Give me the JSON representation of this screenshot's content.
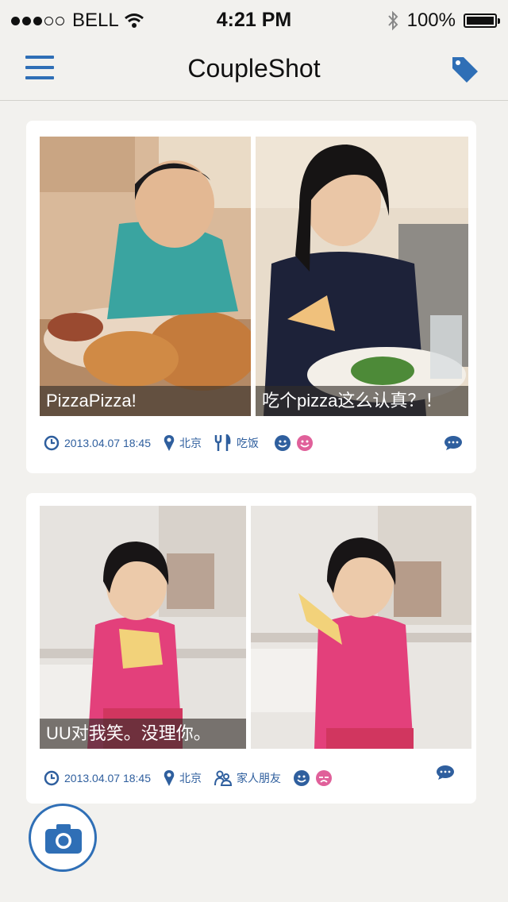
{
  "status_bar": {
    "carrier": "BELL",
    "time": "4:21 PM",
    "battery": "100%",
    "signal_bars_filled": 3,
    "signal_bars_total": 5
  },
  "navbar": {
    "title": "CoupleShot",
    "menu_icon": "hamburger-icon",
    "right_icon": "tag-icon"
  },
  "posts": [
    {
      "photos": [
        {
          "caption": "PizzaPizza!"
        },
        {
          "caption": "吃个pizza这么认真？！"
        }
      ],
      "datetime": "2013.04.07 18:45",
      "location": "北京",
      "category": "吃饭",
      "category_icon": "fork-knife-icon",
      "moods": [
        "happy",
        "happy"
      ]
    },
    {
      "photos": [
        {
          "caption": "UU对我笑。没理你。"
        },
        {
          "caption": ""
        }
      ],
      "datetime": "2013.04.07 18:45",
      "location": "北京",
      "category": "家人朋友",
      "category_icon": "family-icon",
      "moods": [
        "happy",
        "sad"
      ]
    }
  ],
  "colors": {
    "accent": "#2f6fb6",
    "meta_text": "#2f5f9e",
    "mood_pink": "#e0609a",
    "background": "#f2f1ee"
  }
}
